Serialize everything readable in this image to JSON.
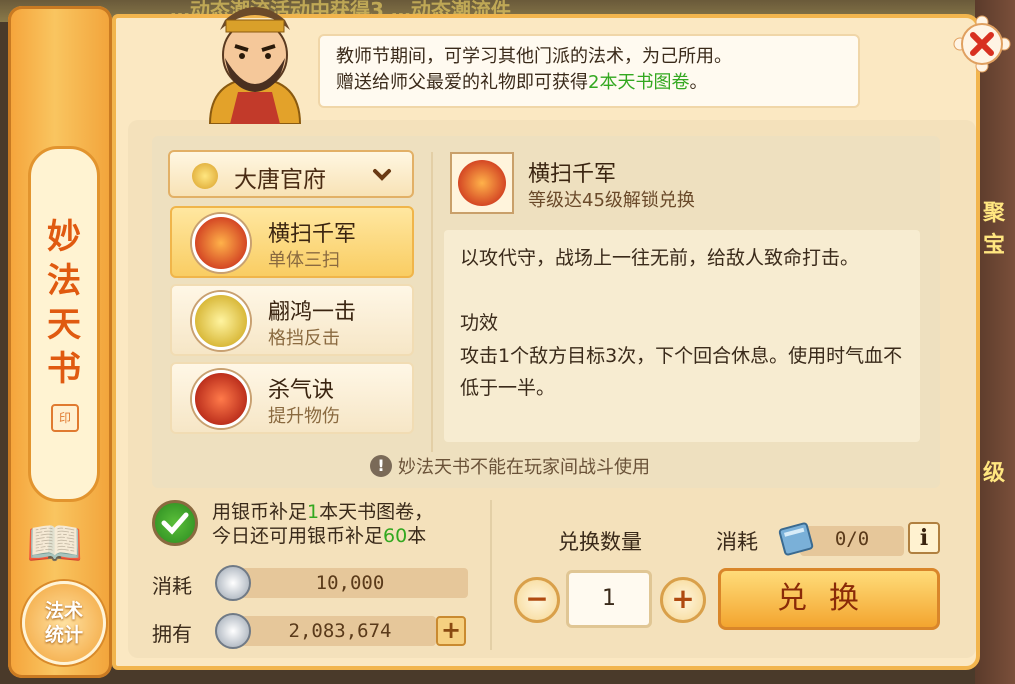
{
  "background": {
    "top_text": "…动态潮流活动中获得3 …动态潮流件",
    "right_texts": [
      "聚宝",
      "级"
    ]
  },
  "banner": {
    "title": "妙法天书",
    "seal": "印",
    "stats_button": "法术统计"
  },
  "header": {
    "speech_line1": "教师节期间，可学习其他门派的法术，为己所用。",
    "speech_line2_prefix": "赠送给师父最爱的礼物即可获得",
    "speech_line2_highlight": "2本天书图卷",
    "speech_line2_suffix": "。"
  },
  "faction": {
    "label": "大唐官府"
  },
  "skills": [
    {
      "name": "横扫千军",
      "sub": "单体三扫",
      "active": true
    },
    {
      "name": "翩鸿一击",
      "sub": "格挡反击",
      "active": false
    },
    {
      "name": "杀气诀",
      "sub": "提升物伤",
      "active": false
    }
  ],
  "detail": {
    "name": "横扫千军",
    "unlock": "等级达45级解锁兑换",
    "description": "以攻代守，战场上一往无前，给敌人致命打击。",
    "effect_title": "功效",
    "effect": "攻击1个敌方目标3次，下个回合休息。使用时气血不低于一半。"
  },
  "notice": {
    "text": "妙法天书不能在玩家间战斗使用"
  },
  "supplement": {
    "line1_prefix": "用银币补足",
    "line1_count": "1",
    "line1_suffix": "本天书图卷，",
    "line2_prefix": "今日还可用银币补足",
    "line2_count": "60",
    "line2_suffix": "本"
  },
  "cost": {
    "label": "消耗",
    "value": "10,000"
  },
  "owned": {
    "label": "拥有",
    "value": "2,083,674"
  },
  "exchange": {
    "qty_label": "兑换数量",
    "qty_value": "1",
    "cost_label": "消耗",
    "cost_value": "0/0",
    "button": "兑换"
  },
  "colors": {
    "highlight_green": "#33a820",
    "accent_orange": "#f2a33a"
  }
}
